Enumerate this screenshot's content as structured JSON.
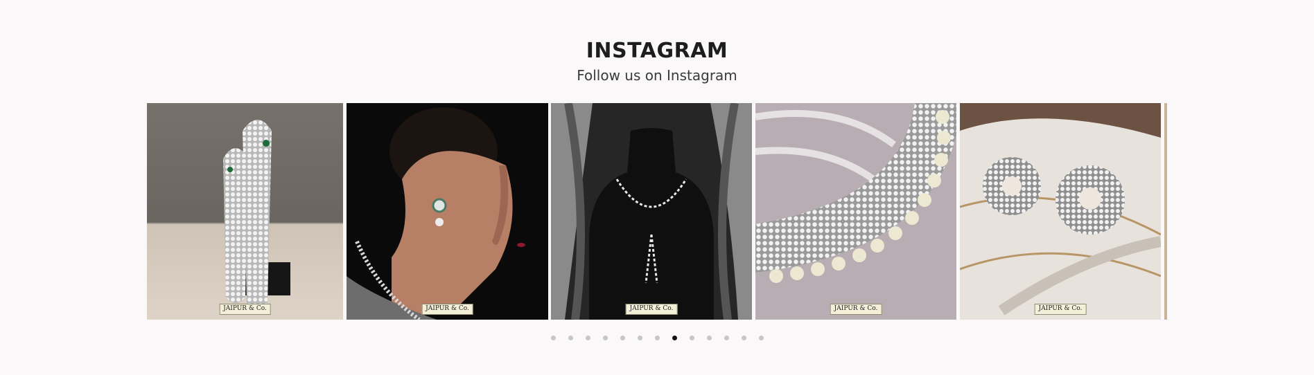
{
  "instagram": {
    "title": "INSTAGRAM",
    "subtitle": "Follow us on Instagram",
    "badge_text": "JAIPUR & Co.",
    "slides": [
      {
        "name": "serpent-earrings-photo"
      },
      {
        "name": "model-earring-portrait-photo"
      },
      {
        "name": "diamond-necklace-bust-photo"
      },
      {
        "name": "pearl-diamond-necklace-photo"
      },
      {
        "name": "pearl-cluster-earrings-photo"
      }
    ],
    "pagination": {
      "count": 13,
      "active_index": 7
    }
  }
}
